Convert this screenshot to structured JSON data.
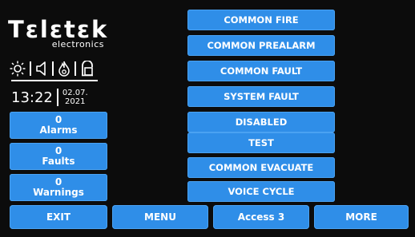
{
  "brand": {
    "name": "Tεlεtεk",
    "subtitle": "electronics"
  },
  "status_icons": [
    "sun-icon",
    "speaker-icon",
    "flame-icon",
    "door-lock-icon"
  ],
  "clock": {
    "time": "13:22",
    "date_line1": "02.07.",
    "date_line2": "2021"
  },
  "counters": [
    {
      "count": "0",
      "label": "Alarms"
    },
    {
      "count": "0",
      "label": "Faults"
    },
    {
      "count": "0",
      "label": "Warnings"
    }
  ],
  "main_buttons": [
    "COMMON FIRE",
    "COMMON PREALARM",
    "COMMON FAULT",
    "SYSTEM FAULT",
    "DISABLED",
    "TEST",
    "COMMON EVACUATE",
    "VOICE CYCLE"
  ],
  "bottom_bar": [
    "EXIT",
    "MENU",
    "Access 3",
    "MORE"
  ],
  "colors": {
    "background": "#0c0c0c",
    "button": "#2f8ee8",
    "text": "#ffffff"
  }
}
